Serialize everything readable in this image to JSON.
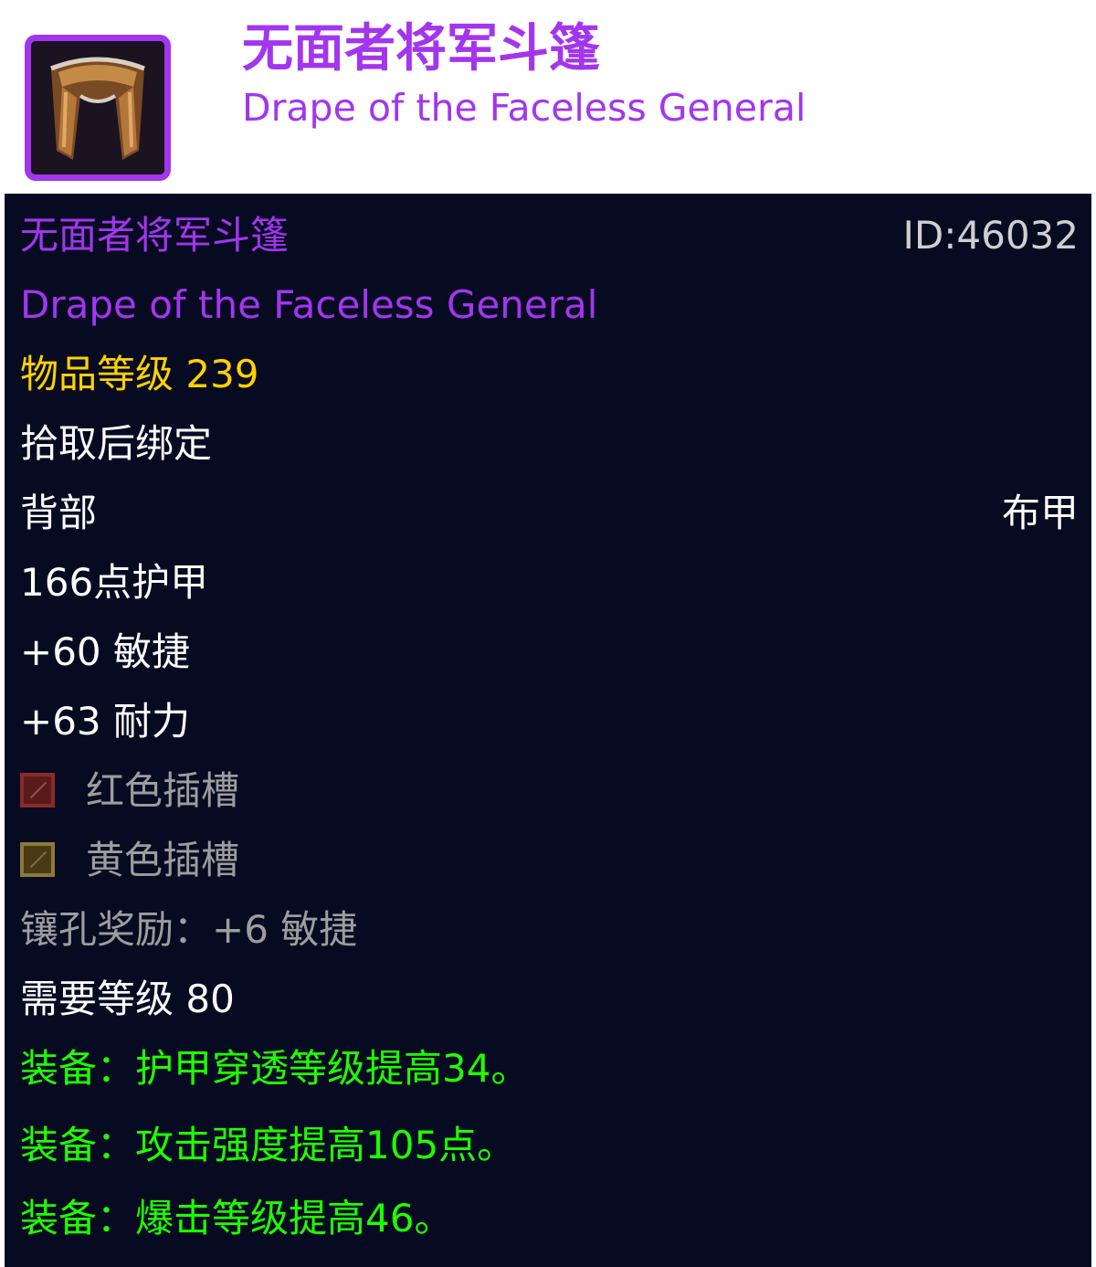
{
  "header": {
    "icon": "cloak-icon",
    "title_cn": "无面者将军斗篷",
    "title_en": "Drape of the Faceless General"
  },
  "tooltip": {
    "name_cn": "无面者将军斗篷",
    "item_id": "ID:46032",
    "name_en": "Drape of the Faceless General",
    "item_level": "物品等级 239",
    "binding": "拾取后绑定",
    "slot": "背部",
    "armor_type": "布甲",
    "armor": "166点护甲",
    "stat_agility": "+60 敏捷",
    "stat_stamina": "+63 耐力",
    "sockets": [
      {
        "icon": "red-socket-icon",
        "label": "红色插槽",
        "color": "#8a2a2a"
      },
      {
        "icon": "yellow-socket-icon",
        "label": "黄色插槽",
        "color": "#8a7a3a"
      }
    ],
    "socket_bonus": "镶孔奖励：+6 敏捷",
    "required_level": "需要等级 80",
    "equip_effects": [
      "装备：护甲穿透等级提高34。",
      "装备：攻击强度提高105点。",
      "装备：爆击等级提高46。"
    ]
  },
  "colors": {
    "epic": "#a335ee",
    "item_level": "#ffd100",
    "equip": "#1eff00",
    "tooltip_bg": "#070b22",
    "muted": "#9d9d9d"
  }
}
